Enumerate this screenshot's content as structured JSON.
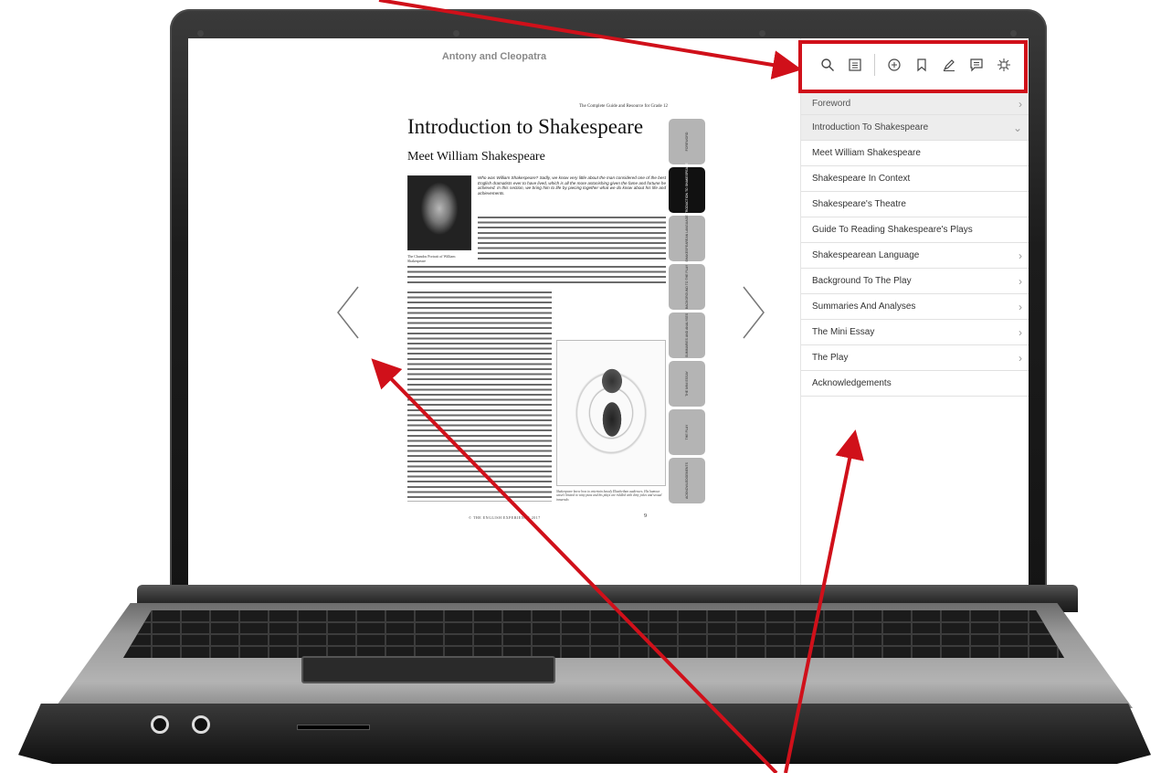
{
  "reader": {
    "book_title": "Antony and Cleopatra",
    "page": {
      "guide_line": "The Complete Guide and Resource for Grade 12",
      "heading": "Introduction to Shakespeare",
      "subheading": "Meet William Shakespeare",
      "portrait_caption": "The Chandos Portrait of William Shakespeare",
      "intro_paragraph": "Who was William Shakespeare? Sadly, we know very little about the man considered one of the best English dramatists ever to have lived, which is all the more astonishing given the fame and fortune he achieved. In this section, we bring him to life by piecing together what we do know about his life and achievements.",
      "illustration_caption": "Shakespeare knew how to entertain bawdy Elizabethan audiences. His humour wasn't limited to witty puns and his plays are riddled with dirty jokes and sexual innuendo.",
      "footer": "© THE ENGLISH EXPERIENCE 2017",
      "page_number": "9"
    },
    "tabs": [
      {
        "label": "Foreword",
        "active": false
      },
      {
        "label": "Introduction to Shakespeare",
        "active": true
      },
      {
        "label": "Shakespearean Language",
        "active": false
      },
      {
        "label": "Background to the Play",
        "active": false
      },
      {
        "label": "Summaries and Analyses",
        "active": false
      },
      {
        "label": "The Mini Essay",
        "active": false
      },
      {
        "label": "The Play",
        "active": false
      },
      {
        "label": "Acknowledgements",
        "active": false
      }
    ]
  },
  "toolbar": {
    "icons": [
      "search-icon",
      "toc-icon",
      "add-note-icon",
      "bookmark-icon",
      "highlight-pen-icon",
      "comment-icon",
      "fullscreen-icon"
    ]
  },
  "toc": {
    "items": [
      {
        "label": "Foreword",
        "chevron": "›"
      },
      {
        "label": "Introduction To Shakespeare",
        "chevron": "⌄"
      },
      {
        "label": "Meet William Shakespeare"
      },
      {
        "label": "Shakespeare In Context"
      },
      {
        "label": "Shakespeare's Theatre"
      },
      {
        "label": "Guide To Reading Shakespeare's Plays"
      },
      {
        "label": "Shakespearean Language",
        "chevron": "›"
      },
      {
        "label": "Background To The Play",
        "chevron": "›"
      },
      {
        "label": "Summaries And Analyses",
        "chevron": "›"
      },
      {
        "label": "The Mini Essay",
        "chevron": "›"
      },
      {
        "label": "The Play",
        "chevron": "›"
      },
      {
        "label": "Acknowledgements"
      }
    ]
  },
  "colors": {
    "annotation": "#d0101a",
    "active_tab": "#111111",
    "tab": "#b4b4b4"
  }
}
